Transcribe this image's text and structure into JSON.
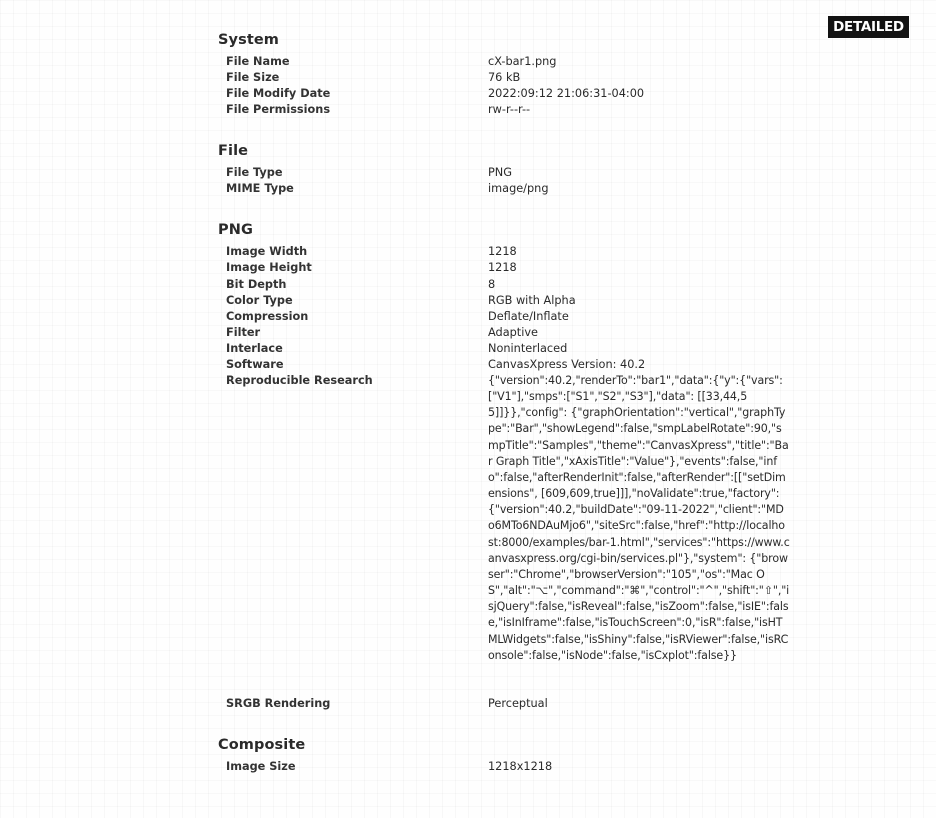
{
  "badge": {
    "label": "DETAILED"
  },
  "sections": {
    "system": {
      "title": "System",
      "rows": [
        {
          "label": "File Name",
          "value": "cX-bar1.png"
        },
        {
          "label": "File Size",
          "value": "76 kB"
        },
        {
          "label": "File Modify Date",
          "value": "2022:09:12 21:06:31-04:00"
        },
        {
          "label": "File Permissions",
          "value": "rw-r--r--"
        }
      ]
    },
    "file": {
      "title": "File",
      "rows": [
        {
          "label": "File Type",
          "value": "PNG"
        },
        {
          "label": "MIME Type",
          "value": "image/png"
        }
      ]
    },
    "png": {
      "title": "PNG",
      "rows": [
        {
          "label": "Image Width",
          "value": "1218"
        },
        {
          "label": "Image Height",
          "value": "1218"
        },
        {
          "label": "Bit Depth",
          "value": "8"
        },
        {
          "label": "Color Type",
          "value": "RGB with Alpha"
        },
        {
          "label": "Compression",
          "value": "Deflate/Inflate"
        },
        {
          "label": "Filter",
          "value": "Adaptive"
        },
        {
          "label": "Interlace",
          "value": "Noninterlaced"
        },
        {
          "label": "Software",
          "value": "CanvasXpress Version: 40.2"
        },
        {
          "label": "Reproducible Research",
          "value": "{\"version\":40.2,\"renderTo\":\"bar1\",\"data\":{\"y\":{\"vars\": [\"V1\"],\"smps\":[\"S1\",\"S2\",\"S3\"],\"data\": [[33,44,55]]}},\"config\": {\"graphOrientation\":\"vertical\",\"graphType\":\"Bar\",\"showLegend\":false,\"smpLabelRotate\":90,\"smpTitle\":\"Samples\",\"theme\":\"CanvasXpress\",\"title\":\"Bar Graph Title\",\"xAxisTitle\":\"Value\"},\"events\":false,\"info\":false,\"afterRenderInit\":false,\"afterRender\":[[\"setDimensions\", [609,609,true]]],\"noValidate\":true,\"factory\": {\"version\":40.2,\"buildDate\":\"09-11-2022\",\"client\":\"MDo6MTo6NDAuMjo6\",\"siteSrc\":false,\"href\":\"http://localhost:8000/examples/bar-1.html\",\"services\":\"https://www.canvasxpress.org/cgi-bin/services.pl\"},\"system\": {\"browser\":\"Chrome\",\"browserVersion\":\"105\",\"os\":\"Mac OS\",\"alt\":\"⌥\",\"command\":\"⌘\",\"control\":\"^\",\"shift\":\"⇧\",\"isjQuery\":false,\"isReveal\":false,\"isZoom\":false,\"isIE\":false,\"isInIframe\":false,\"isTouchScreen\":0,\"isR\":false,\"isHTMLWidgets\":false,\"isShiny\":false,\"isRViewer\":false,\"isRConsole\":false,\"isNode\":false,\"isCxplot\":false}}"
        },
        {
          "label": "SRGB Rendering",
          "value": "Perceptual"
        }
      ]
    },
    "composite": {
      "title": "Composite",
      "rows": [
        {
          "label": "Image Size",
          "value": "1218x1218"
        }
      ]
    }
  }
}
